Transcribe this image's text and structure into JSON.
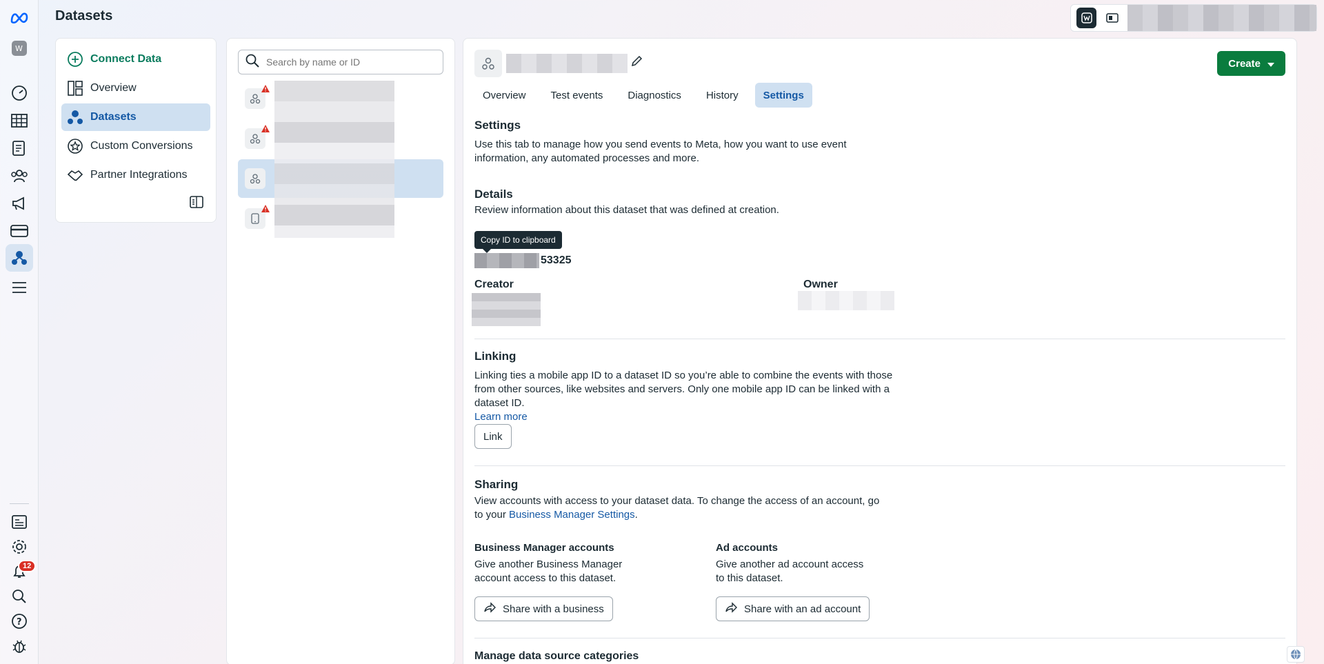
{
  "page": {
    "title": "Datasets"
  },
  "rail": {
    "icons": [
      "meta-logo-icon",
      "workspace-icon",
      "dashboard-icon",
      "table-icon",
      "reports-icon",
      "audiences-icon",
      "ads-megaphone-icon",
      "billing-card-icon",
      "datasets-icon",
      "all-tools-icon",
      "pages-icon",
      "settings-gear-icon",
      "notifications-bell-icon",
      "search-icon",
      "help-icon",
      "bug-report-icon"
    ],
    "notification_count": "12"
  },
  "nav": {
    "items": [
      {
        "label": "Connect Data"
      },
      {
        "label": "Overview"
      },
      {
        "label": "Datasets"
      },
      {
        "label": "Custom Conversions"
      },
      {
        "label": "Partner Integrations"
      }
    ]
  },
  "list": {
    "search_placeholder": "Search by name or ID"
  },
  "detail": {
    "tabs": [
      {
        "label": "Overview"
      },
      {
        "label": "Test events"
      },
      {
        "label": "Diagnostics"
      },
      {
        "label": "History"
      },
      {
        "label": "Settings"
      }
    ],
    "create_label": "Create",
    "settings": {
      "title": "Settings",
      "text": "Use this tab to manage how you send events to Meta, how you want to use event information, any automated processes and more."
    },
    "details": {
      "title": "Details",
      "text": "Review information about this dataset that was defined at creation.",
      "tooltip": "Copy ID to clipboard",
      "id_suffix": "53325",
      "creator_label": "Creator",
      "owner_label": "Owner"
    },
    "linking": {
      "title": "Linking",
      "text": "Linking ties a mobile app ID to a dataset ID so you’re able to combine the events with those from other sources, like websites and servers. Only one mobile app ID can be linked with a dataset ID.",
      "learn_more": "Learn more",
      "link_button": "Link"
    },
    "sharing": {
      "title": "Sharing",
      "text_before": "View accounts with access to your dataset data. To change the access of an account, go to your ",
      "link": "Business Manager Settings",
      "text_after": ".",
      "bm_title": "Business Manager accounts",
      "bm_text": "Give another Business Manager account access to this dataset.",
      "bm_button": "Share with a business",
      "ad_title": "Ad accounts",
      "ad_text": "Give another ad account access to this dataset.",
      "ad_button": "Share with an ad account"
    },
    "manage": {
      "title": "Manage data source categories"
    }
  },
  "colors": {
    "accent_blue": "#1559a5",
    "create_green": "#0a7c3e",
    "warning_red": "#d93025"
  }
}
